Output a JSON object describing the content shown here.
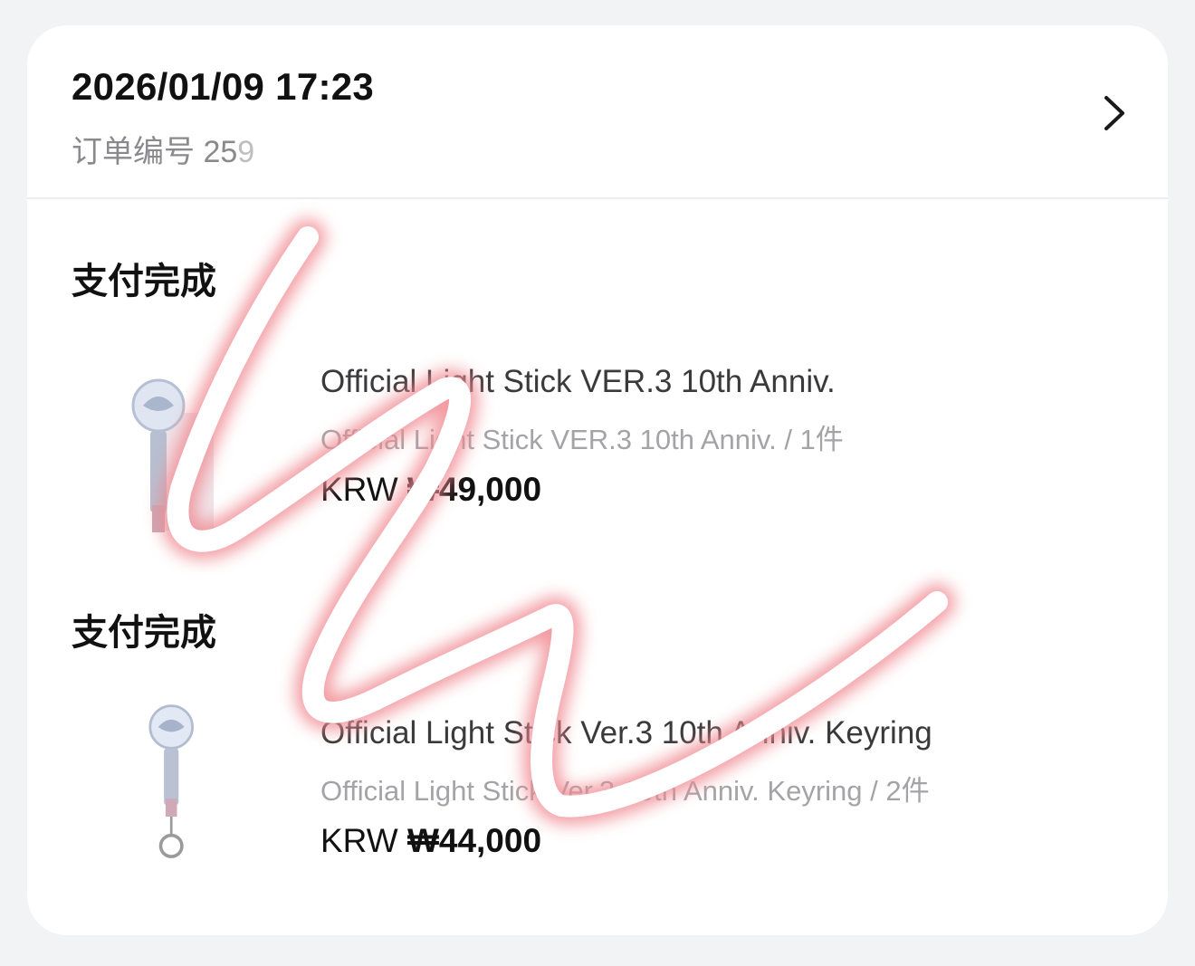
{
  "order": {
    "datetime": "2026/01/09 17:23",
    "number_label": "订单编号",
    "number_value": "25",
    "number_cut": "9"
  },
  "items": [
    {
      "status": "支付完成",
      "title": "Official Light Stick VER.3 10th Anniv.",
      "subtitle": "Official Light Stick VER.3 10th Anniv. / 1件",
      "currency": "KRW",
      "price": "₩49,000",
      "thumbnail": "light-stick"
    },
    {
      "status": "支付完成",
      "title": "Official Light Stick Ver.3 10th Anniv. Keyring",
      "subtitle": "Official Light Stick Ver.3 10th Anniv. Keyring / 2件",
      "currency": "KRW",
      "price": "₩44,000",
      "thumbnail": "light-stick-keyring"
    }
  ],
  "icons": {
    "chevron": "chevron-right-icon"
  },
  "colors": {
    "scribble_glow": "#f08a92",
    "scribble_core": "#ffffff"
  }
}
